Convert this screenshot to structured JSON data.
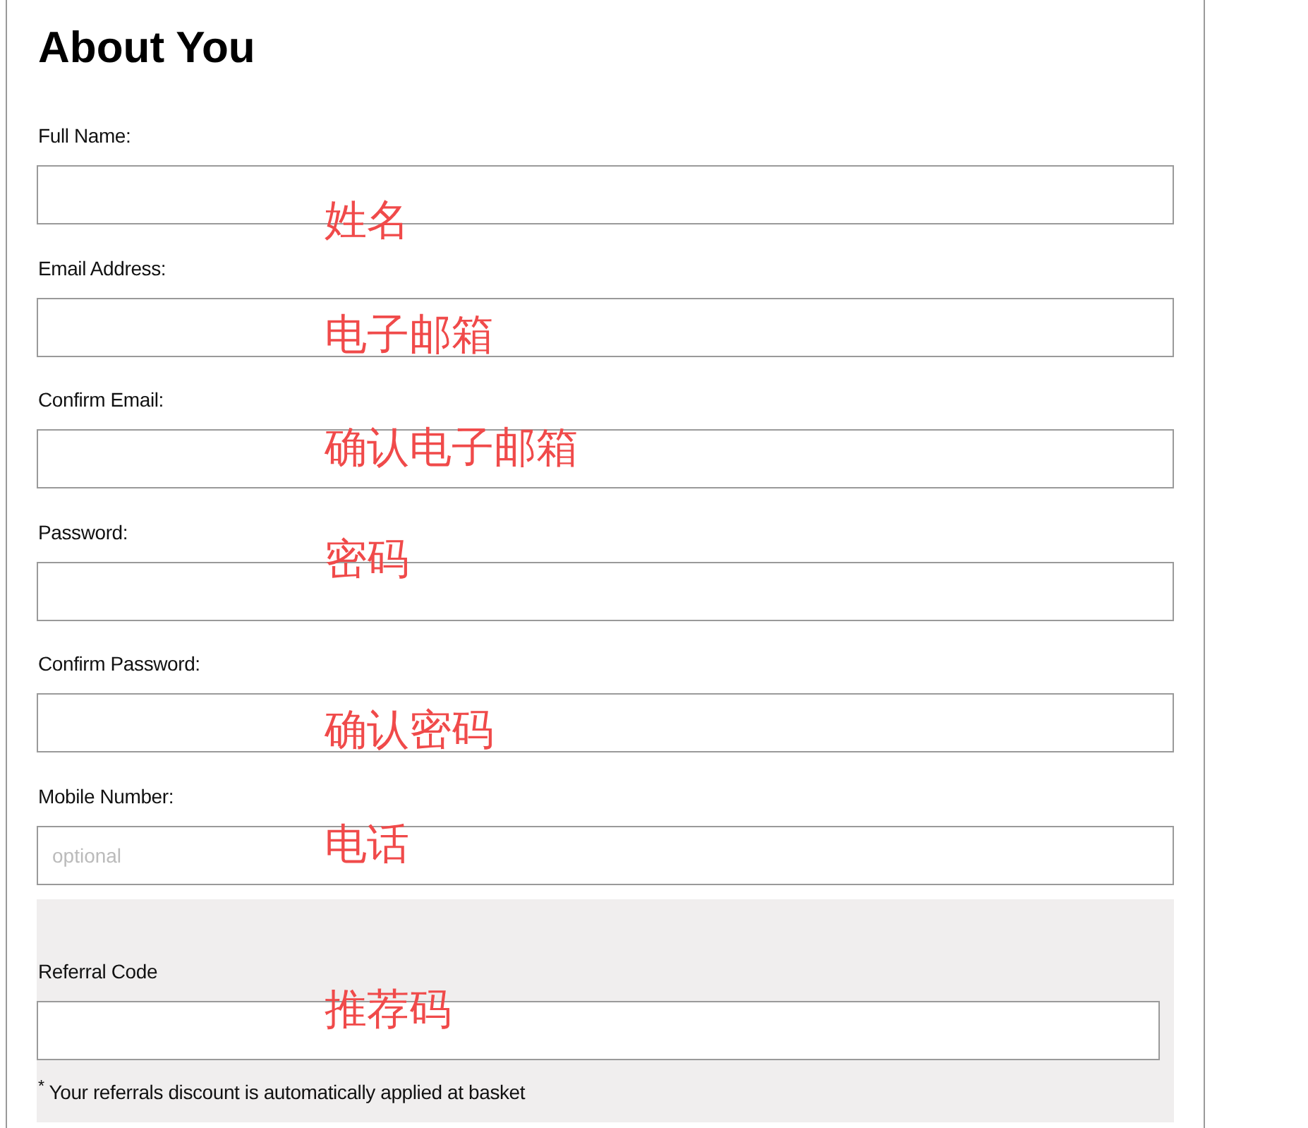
{
  "heading": "About You",
  "fields": [
    {
      "label": "Full Name:",
      "annotation": "姓名"
    },
    {
      "label": "Email Address:",
      "annotation": "电子邮箱"
    },
    {
      "label": "Confirm Email:",
      "annotation": "确认电子邮箱"
    },
    {
      "label": "Password:",
      "annotation": "密码"
    },
    {
      "label": "Confirm Password:",
      "annotation": "确认密码"
    },
    {
      "label": "Mobile Number:",
      "placeholder": "optional",
      "annotation": "电话"
    }
  ],
  "referral": {
    "label": "Referral Code",
    "annotation": "推荐码",
    "note": "$^{*}$ Your referrals discount is automatically applied at basket"
  }
}
